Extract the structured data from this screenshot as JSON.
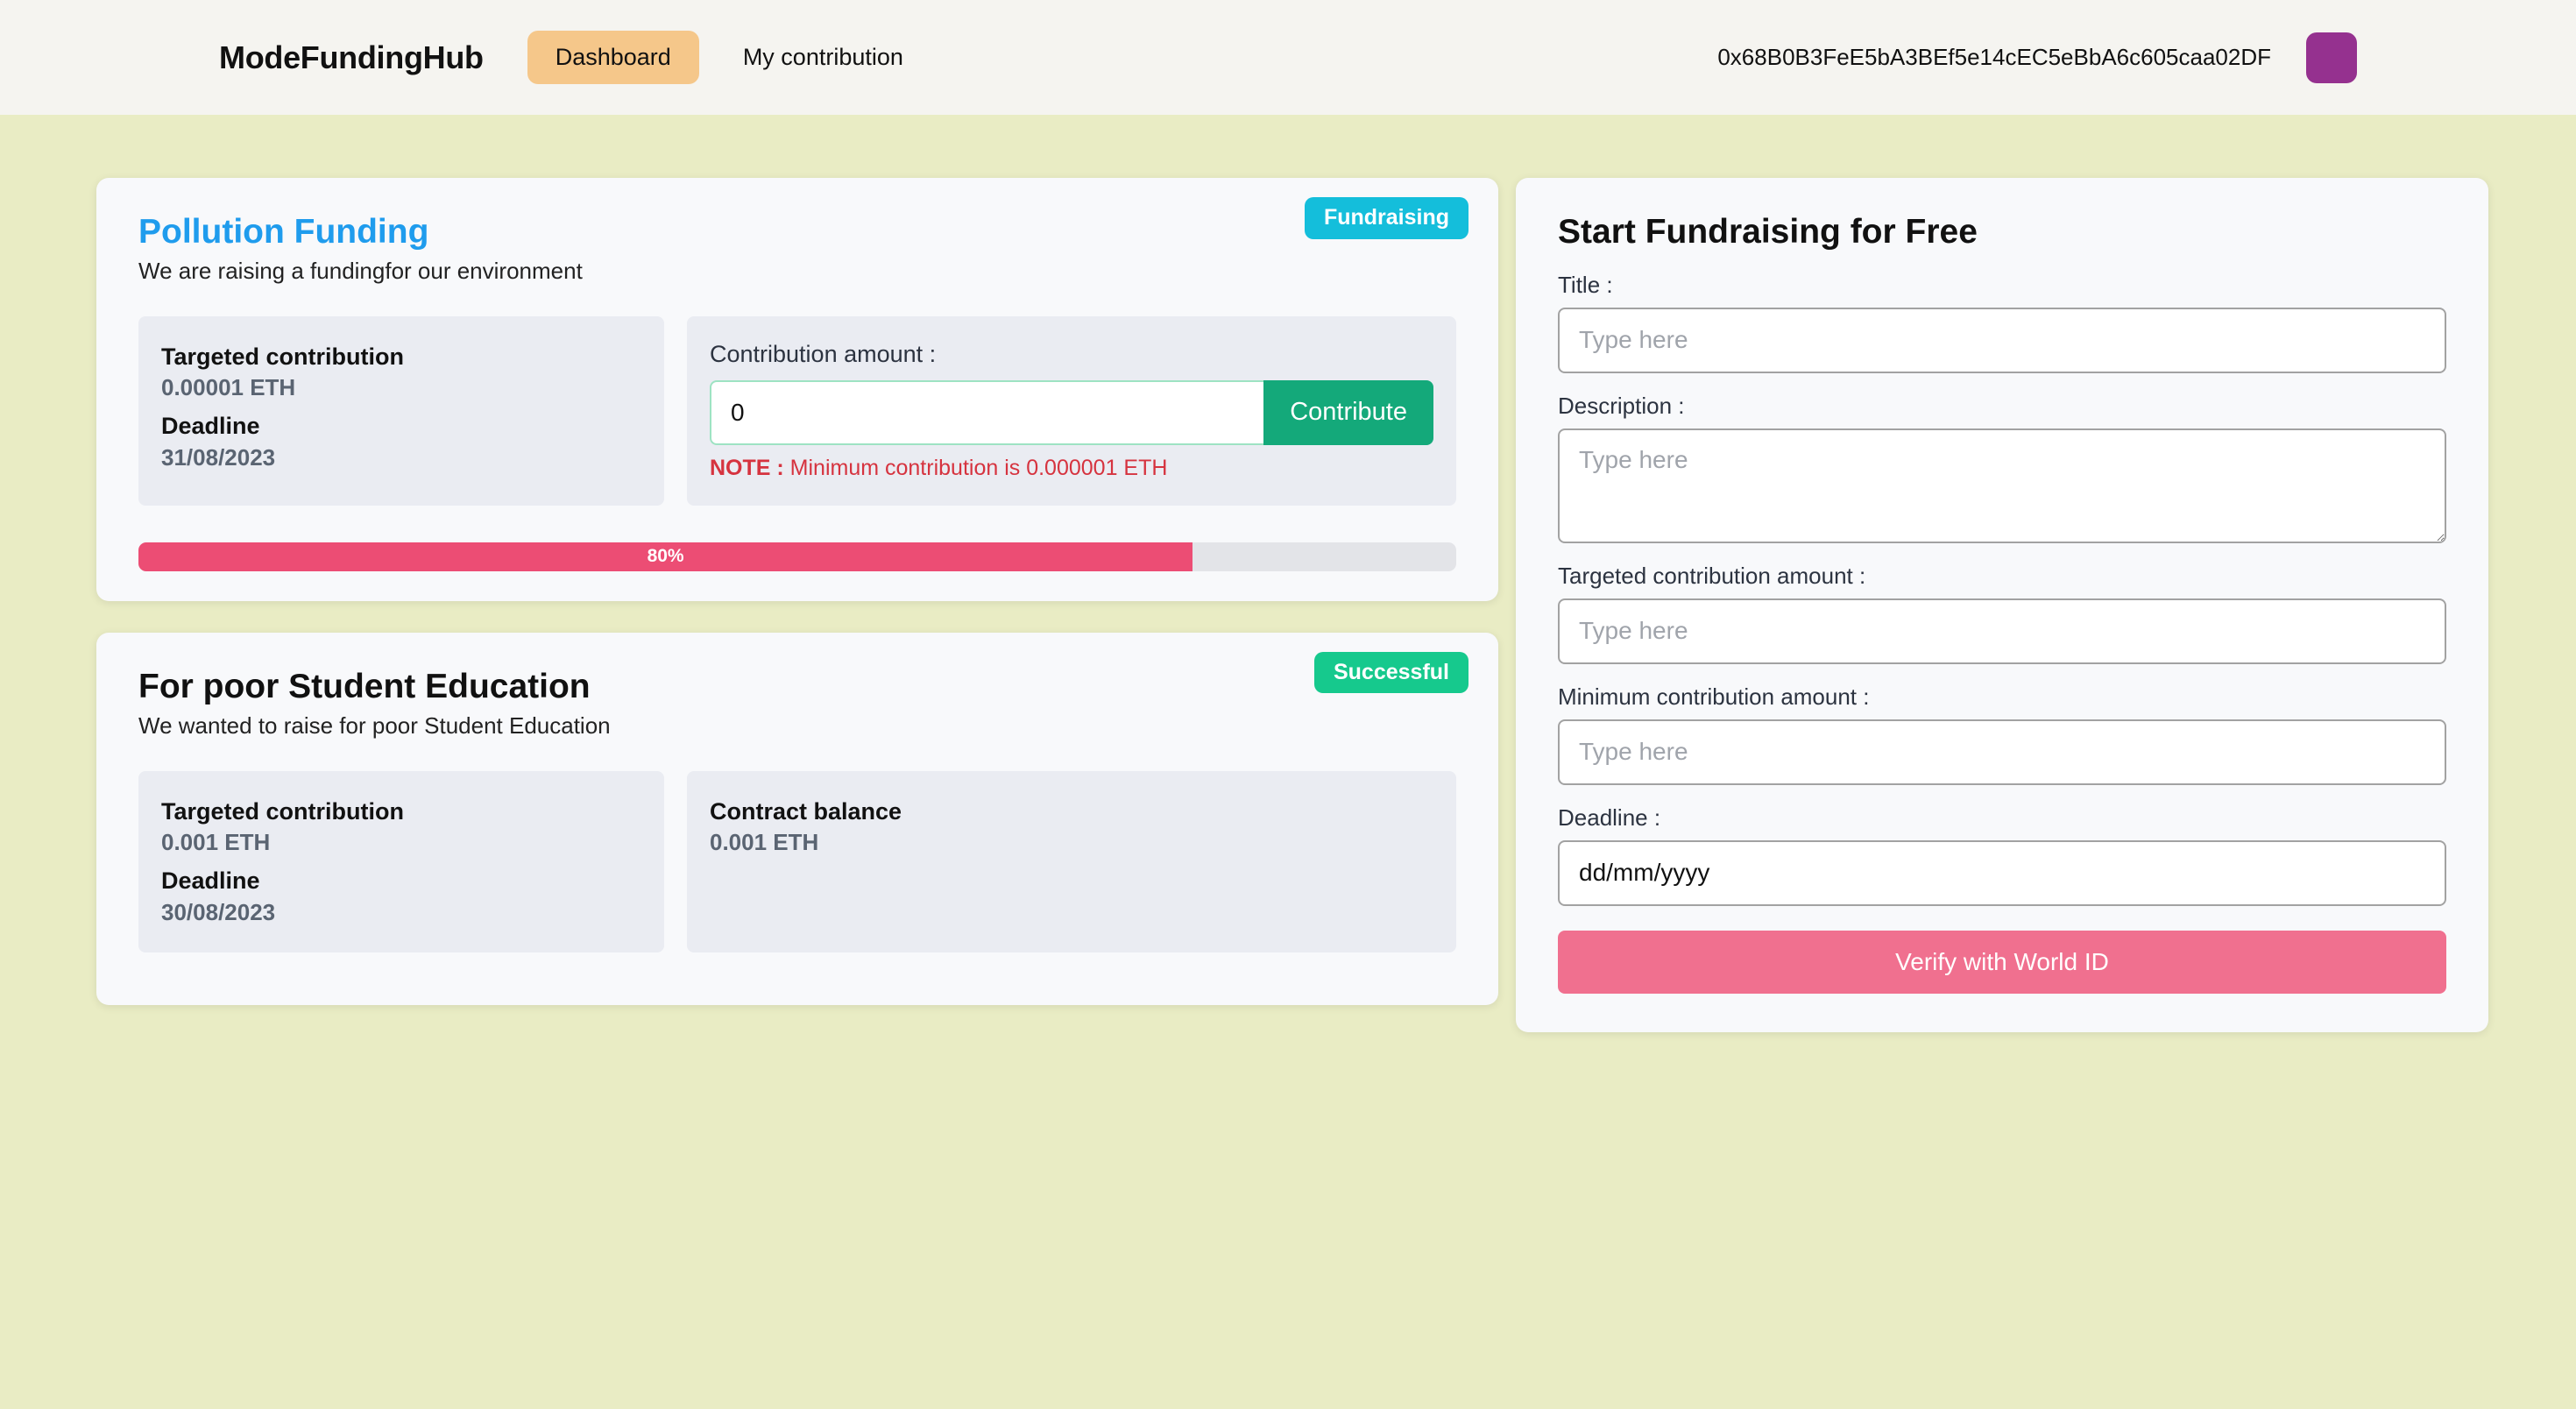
{
  "header": {
    "brand": "ModeFundingHub",
    "nav": [
      {
        "label": "Dashboard",
        "name": "nav-dashboard",
        "active": true
      },
      {
        "label": "My contribution",
        "name": "nav-my-contribution",
        "active": false
      }
    ],
    "wallet_address": "0x68B0B3FeE5bA3BEf5e14cEC5eBbA6c605caa02DF",
    "avatar_color": "#95318f",
    "active_nav_color": "#f5c78a"
  },
  "campaigns": [
    {
      "badge": "Fundraising",
      "badge_color": "#14bedb",
      "title": "Pollution Funding",
      "title_color": "#1f9ced",
      "description": "We are raising a fundingfor our environment",
      "targeted_label": "Targeted contribution",
      "targeted_value": "0.00001 ETH",
      "deadline_label": "Deadline",
      "deadline_value": "31/08/2023",
      "contribution_label": "Contribution amount :",
      "contribution_value": "0",
      "contribute_button": "Contribute",
      "note_prefix": "NOTE :",
      "note_text": " Minimum contribution is 0.000001 ETH",
      "progress_percent": "80%",
      "progress_value": 80,
      "progress_color": "#ec4d74"
    },
    {
      "badge": "Successful",
      "badge_color": "#16c98d",
      "title": "For poor Student Education",
      "title_color": "#111111",
      "description": "We wanted to raise for poor Student Education",
      "targeted_label": "Targeted contribution",
      "targeted_value": "0.001 ETH",
      "deadline_label": "Deadline",
      "deadline_value": "30/08/2023",
      "balance_label": "Contract balance",
      "balance_value": "0.001 ETH"
    }
  ],
  "form": {
    "title": "Start Fundraising for Free",
    "fields": [
      {
        "label": "Title :",
        "placeholder": "Type here",
        "value": ""
      },
      {
        "label": "Description :",
        "placeholder": "Type here",
        "value": ""
      },
      {
        "label": "Targeted contribution amount :",
        "placeholder": "Type here",
        "value": ""
      },
      {
        "label": "Minimum contribution amount :",
        "placeholder": "Type here",
        "value": ""
      },
      {
        "label": "Deadline :",
        "placeholder": "dd/mm/yyyy",
        "value": "dd/mm/yyyy"
      }
    ],
    "submit_label": "Verify with World ID",
    "submit_color": "#f0708f"
  }
}
